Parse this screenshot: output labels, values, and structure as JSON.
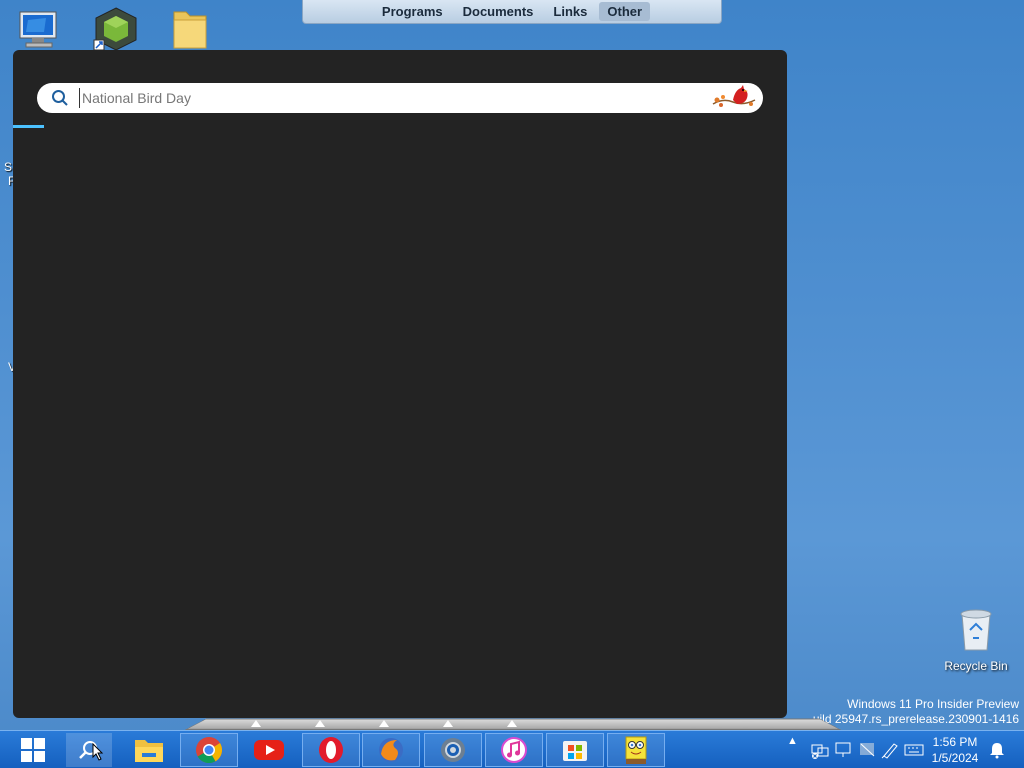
{
  "top_toolbar": {
    "tabs": [
      {
        "label": "Programs",
        "active": false
      },
      {
        "label": "Documents",
        "active": false
      },
      {
        "label": "Links",
        "active": false
      },
      {
        "label": "Other",
        "active": true
      }
    ]
  },
  "search_panel": {
    "search": {
      "placeholder": "National Bird Day",
      "value": ""
    },
    "progress_fraction": 0.04
  },
  "desktop": {
    "icons": [
      "computer-icon",
      "package-shortcut-icon",
      "folder-icon"
    ],
    "recycle_bin_label": "Recycle Bin",
    "edge_text": [
      "S",
      "F",
      "V"
    ]
  },
  "watermark": {
    "line1": "Windows 11 Pro Insider Preview",
    "line2": "uild 25947.rs_prerelease.230901-1416"
  },
  "taskbar": {
    "apps": [
      "start-icon",
      "search-icon",
      "file-explorer-icon",
      "chrome-icon",
      "youtube-icon",
      "opera-icon",
      "firefox-icon",
      "settings-icon",
      "itunes-icon",
      "microsoft-store-icon",
      "spongebob-app-icon"
    ],
    "clock_time": "1:56 PM",
    "clock_date": "1/5/2024"
  },
  "colors": {
    "accent": "#4cc2ff",
    "panel_bg": "#232323",
    "taskbar": "#1a68c8"
  }
}
